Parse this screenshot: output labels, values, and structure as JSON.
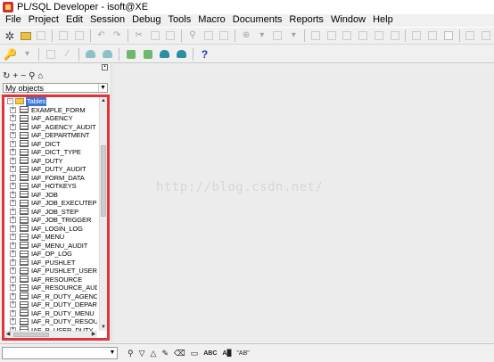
{
  "window": {
    "title": "PL/SQL Developer - isoft@XE"
  },
  "menu": [
    "File",
    "Project",
    "Edit",
    "Session",
    "Debug",
    "Tools",
    "Macro",
    "Documents",
    "Reports",
    "Window",
    "Help"
  ],
  "object_browser": {
    "filter_value": "My objects",
    "tree": {
      "root_label": "Tables",
      "items": [
        "EXAMPLE_FORM",
        "IAF_AGENCY",
        "IAF_AGENCY_AUDIT",
        "IAF_DEPARTMENT",
        "IAF_DICT",
        "IAF_DICT_TYPE",
        "IAF_DUTY",
        "IAF_DUTY_AUDIT",
        "IAF_FORM_DATA",
        "IAF_HOTKEYS",
        "IAF_JOB",
        "IAF_JOB_EXECUTEPLA",
        "IAF_JOB_STEP",
        "IAF_JOB_TRIGGER",
        "IAF_LOGIN_LOG",
        "IAF_MENU",
        "IAF_MENU_AUDIT",
        "IAF_OP_LOG",
        "IAF_PUSHLET",
        "IAF_PUSHLET_USER",
        "IAF_RESOURCE",
        "IAF_RESOURCE_AUDI",
        "IAF_R_DUTY_AGENCY",
        "IAF_R_DUTY_DEPART",
        "IAF_R_DUTY_MENU",
        "IAF_R_DUTY_RESOUR",
        "IAF_R_USER_DUTY_A"
      ]
    }
  },
  "workspace": {
    "watermark": "http://blog.csdn.net/"
  },
  "statusbar": {
    "find_value": ""
  },
  "colors": {
    "highlight_border": "#e0343a",
    "selection": "#3a78d8"
  }
}
